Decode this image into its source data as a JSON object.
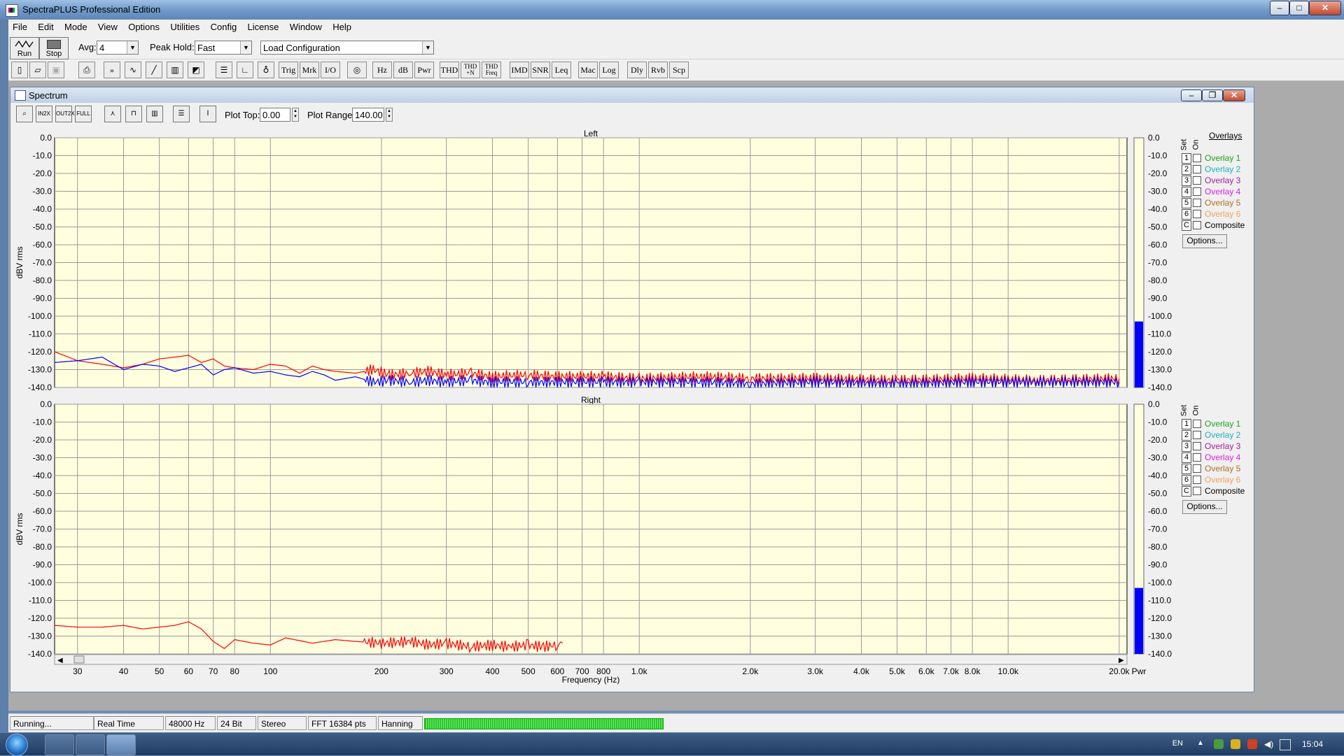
{
  "window": {
    "title": "SpectraPLUS Professional Edition",
    "min": "–",
    "max": "□",
    "close": "✕"
  },
  "menu": [
    "File",
    "Edit",
    "Mode",
    "View",
    "Options",
    "Utilities",
    "Config",
    "License",
    "Window",
    "Help"
  ],
  "toolbar": {
    "run_label": "Run",
    "stop_label": "Stop",
    "avg_label": "Avg:",
    "avg_value": "4",
    "peak_label": "Peak Hold:",
    "peak_value": "Fast",
    "config_value": "Load Configuration"
  },
  "toolbar2": [
    "Trig",
    "Mrk",
    "I/O",
    "Hz",
    "dB",
    "Pwr",
    "THD",
    "THD +N",
    "THD Freq",
    "IMD",
    "SNR",
    "Leq",
    "Mac",
    "Log",
    "Dly",
    "Rvb",
    "Scp"
  ],
  "spectrum": {
    "title": "Spectrum",
    "plot_top_label": "Plot Top:",
    "plot_top_value": "0.00",
    "plot_range_label": "Plot Range:",
    "plot_range_value": "140.00",
    "overlays_title": "Overlays",
    "set_label": "Set",
    "on_label": "On",
    "options_label": "Options...",
    "overlays": [
      {
        "set": "1",
        "name": "Overlay 1",
        "color": "#20a020"
      },
      {
        "set": "2",
        "name": "Overlay 2",
        "color": "#20b0c0"
      },
      {
        "set": "3",
        "name": "Overlay 3",
        "color": "#a020a0"
      },
      {
        "set": "4",
        "name": "Overlay 4",
        "color": "#e020e0"
      },
      {
        "set": "5",
        "name": "Overlay 5",
        "color": "#b07020"
      },
      {
        "set": "6",
        "name": "Overlay 6",
        "color": "#f0a060"
      },
      {
        "set": "C",
        "name": "Composite",
        "color": "#000000"
      }
    ]
  },
  "chart_data": [
    {
      "type": "line",
      "title": "Left",
      "ylabel": "dBV rms",
      "xlabel": "Frequency (Hz)",
      "xscale": "log",
      "xlim": [
        26,
        21000
      ],
      "ylim": [
        -140,
        0
      ],
      "y_ticks": [
        "0.0",
        "-10.0",
        "-20.0",
        "-30.0",
        "-40.0",
        "-50.0",
        "-60.0",
        "-70.0",
        "-80.0",
        "-90.0",
        "-100.0",
        "-110.0",
        "-120.0",
        "-130.0",
        "-140.0"
      ],
      "x_ticks": [
        {
          "v": 30,
          "label": "30"
        },
        {
          "v": 40,
          "label": "40"
        },
        {
          "v": 50,
          "label": "50"
        },
        {
          "v": 60,
          "label": "60"
        },
        {
          "v": 70,
          "label": "70"
        },
        {
          "v": 80,
          "label": "80"
        },
        {
          "v": 100,
          "label": "100"
        },
        {
          "v": 200,
          "label": "200"
        },
        {
          "v": 300,
          "label": "300"
        },
        {
          "v": 400,
          "label": "400"
        },
        {
          "v": 500,
          "label": "500"
        },
        {
          "v": 600,
          "label": "600"
        },
        {
          "v": 700,
          "label": "700"
        },
        {
          "v": 800,
          "label": "800"
        },
        {
          "v": 1000,
          "label": "1.0k"
        },
        {
          "v": 2000,
          "label": "2.0k"
        },
        {
          "v": 3000,
          "label": "3.0k"
        },
        {
          "v": 4000,
          "label": "4.0k"
        },
        {
          "v": 5000,
          "label": "5.0k"
        },
        {
          "v": 6000,
          "label": "6.0k"
        },
        {
          "v": 7000,
          "label": "7.0k"
        },
        {
          "v": 8000,
          "label": "8.0k"
        },
        {
          "v": 10000,
          "label": "10.0k"
        },
        {
          "v": 20000,
          "label": "20.0k"
        }
      ],
      "series": [
        {
          "color": "#ff0000",
          "x": [
            26,
            30,
            35,
            40,
            45,
            50,
            55,
            60,
            65,
            70,
            75,
            80,
            90,
            100,
            110,
            120,
            130,
            140,
            150,
            170,
            190,
            210,
            240,
            270,
            300,
            350,
            400,
            500,
            600,
            800,
            1000,
            1500,
            2000,
            3000,
            5000,
            8000,
            12000,
            20000
          ],
          "y": [
            -120,
            -125,
            -127,
            -129,
            -127,
            -124,
            -123,
            -122,
            -126,
            -124,
            -128,
            -129,
            -130,
            -127,
            -128,
            -132,
            -128,
            -130,
            -131,
            -132,
            -130,
            -133,
            -132,
            -131,
            -133,
            -132,
            -134,
            -133,
            -134,
            -134,
            -135,
            -134,
            -135,
            -135,
            -136,
            -135,
            -136,
            -135
          ]
        },
        {
          "color": "#0000ff",
          "x": [
            26,
            30,
            35,
            40,
            45,
            50,
            55,
            60,
            65,
            70,
            75,
            80,
            90,
            100,
            110,
            120,
            130,
            140,
            150,
            170,
            190,
            210,
            240,
            270,
            300,
            350,
            400,
            500,
            600,
            800,
            1000,
            1500,
            2000,
            3000,
            5000,
            8000,
            12000,
            20000
          ],
          "y": [
            -126,
            -125,
            -123,
            -130,
            -127,
            -128,
            -131,
            -129,
            -127,
            -133,
            -130,
            -129,
            -132,
            -131,
            -133,
            -134,
            -131,
            -133,
            -136,
            -134,
            -137,
            -136,
            -137,
            -136,
            -137,
            -136,
            -137,
            -137,
            -137,
            -137,
            -137,
            -137,
            -138,
            -137,
            -138,
            -137,
            -137,
            -137
          ]
        }
      ],
      "meter_level": -103
    },
    {
      "type": "line",
      "title": "Right",
      "ylabel": "dBV rms",
      "xlabel": "Frequency (Hz)",
      "xscale": "log",
      "xlim": [
        26,
        21000
      ],
      "ylim": [
        -140,
        0
      ],
      "y_ticks": [
        "0.0",
        "-10.0",
        "-20.0",
        "-30.0",
        "-40.0",
        "-50.0",
        "-60.0",
        "-70.0",
        "-80.0",
        "-90.0",
        "-100.0",
        "-110.0",
        "-120.0",
        "-130.0",
        "-140.0"
      ],
      "series": [
        {
          "color": "#ff0000",
          "x": [
            26,
            30,
            35,
            40,
            45,
            50,
            55,
            60,
            65,
            70,
            75,
            80,
            90,
            100,
            110,
            130,
            150,
            170,
            200,
            240,
            270,
            300,
            350,
            400,
            450,
            500,
            550,
            600,
            620
          ],
          "y": [
            -124,
            -125,
            -125,
            -124,
            -126,
            -125,
            -124,
            -122,
            -126,
            -133,
            -137,
            -132,
            -134,
            -135,
            -131,
            -134,
            -132,
            -133,
            -134,
            -133,
            -135,
            -134,
            -136,
            -135,
            -136,
            -135,
            -136,
            -135,
            -134
          ]
        }
      ],
      "meter_level": -103
    }
  ],
  "pwr_label": "Pwr",
  "status": {
    "state": "Running...",
    "mode": "Real Time",
    "rate": "48000 Hz",
    "bits": "24 Bit",
    "channels": "Stereo",
    "fft": "FFT 16384 pts",
    "window": "Hanning"
  },
  "taskbar": {
    "lang": "EN",
    "time": "15:04"
  }
}
